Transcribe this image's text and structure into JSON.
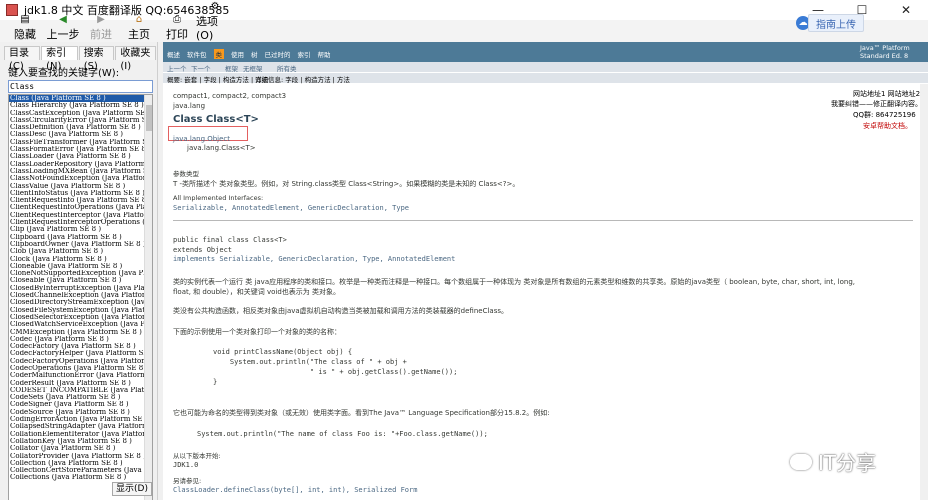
{
  "window": {
    "title": "jdk1.8 中文 百度翻译版 QQ:654638585",
    "controls": [
      "—",
      "☐",
      "✕"
    ]
  },
  "toolbar": {
    "buttons": [
      {
        "label": "隐藏",
        "icon": "hide-icon",
        "enabled": true
      },
      {
        "label": "上一步",
        "icon": "back-icon",
        "enabled": true
      },
      {
        "label": "前进",
        "icon": "forward-icon",
        "enabled": false
      },
      {
        "label": "主页",
        "icon": "home-icon",
        "enabled": true
      },
      {
        "label": "打印",
        "icon": "print-icon",
        "enabled": true
      },
      {
        "label": "选项(O)",
        "icon": "options-icon",
        "enabled": true
      }
    ],
    "cloud_upload": "指南上传"
  },
  "left_panel": {
    "tabs": [
      "目录(C)",
      "索引(N)",
      "搜索(S)",
      "收藏夹(I)"
    ],
    "active_tab": 1,
    "keyword_label": "键入要查找的关键字(W):",
    "search_value": "Class",
    "show_button": "显示(D)",
    "items": [
      "Class (Java Platform SE 8 )",
      "Class Hierarchy (Java Platform SE 8 )",
      "ClassCastException (Java Platform SE 8 )",
      "ClassCircularityError (Java Platform SE 8 )",
      "ClassDefinition (Java Platform SE 8 )",
      "ClassDesc (Java Platform SE 8 )",
      "ClassFileTransformer (Java Platform SE 8 )",
      "ClassFormatError (Java Platform SE 8 )",
      "ClassLoader (Java Platform SE 8 )",
      "ClassLoaderRepository (Java Platform SE 8 )",
      "ClassLoadingMXBean (Java Platform SE 8 )",
      "ClassNotFoundException (Java Platform SE 8 )",
      "ClassValue (Java Platform SE 8 )",
      "ClientInfoStatus (Java Platform SE 8 )",
      "ClientRequestInfo (Java Platform SE 8 )",
      "ClientRequestInfoOperations (Java Platform SE 8 )",
      "ClientRequestInterceptor (Java Platform SE 8 )",
      "ClientRequestInterceptorOperations (Java Platform SE 8 )",
      "Clip (Java Platform SE 8 )",
      "Clipboard (Java Platform SE 8 )",
      "ClipboardOwner (Java Platform SE 8 )",
      "Clob (Java Platform SE 8 )",
      "Clock (Java Platform SE 8 )",
      "Cloneable (Java Platform SE 8 )",
      "CloneNotSupportedException (Java Platform SE 8 )",
      "Closeable (Java Platform SE 8 )",
      "ClosedByInterruptException (Java Platform SE 8 )",
      "ClosedChannelException (Java Platform SE 8 )",
      "ClosedDirectoryStreamException (Java Platform SE 8 )",
      "ClosedFileSystemException (Java Platform SE 8 )",
      "ClosedSelectorException (Java Platform SE 8 )",
      "ClosedWatchServiceException (Java Platform SE 8 )",
      "CMMException (Java Platform SE 8 )",
      "Codec (Java Platform SE 8 )",
      "CodecFactory (Java Platform SE 8 )",
      "CodecFactoryHelper (Java Platform SE 8 )",
      "CodecFactoryOperations (Java Platform SE 8 )",
      "CodecOperations (Java Platform SE 8 )",
      "CoderMalfunctionError (Java Platform SE 8 )",
      "CoderResult (Java Platform SE 8 )",
      "CODESET_INCOMPATIBLE (Java Platform SE 8 )",
      "CodeSets (Java Platform SE 8 )",
      "CodeSigner (Java Platform SE 8 )",
      "CodeSource (Java Platform SE 8 )",
      "CodingErrorAction (Java Platform SE 8 )",
      "CollapsedStringAdapter (Java Platform SE 8 )",
      "CollationElementIterator (Java Platform SE 8 )",
      "CollationKey (Java Platform SE 8 )",
      "Collator (Java Platform SE 8 )",
      "CollatorProvider (Java Platform SE 8 )",
      "Collection (Java Platform SE 8 )",
      "CollectionCertStoreParameters (Java Platform SE 8 )",
      "Collections (Java Platform SE 8 )"
    ]
  },
  "doc": {
    "navbar_links": [
      "概述",
      "软件包",
      "类",
      "使用",
      "树",
      "已过时的",
      "索引",
      "帮助"
    ],
    "navbar_current": 2,
    "brand_line1": "Java™ Platform",
    "brand_line2": "Standard Ed. 8",
    "subnav1": [
      "上一个",
      "下一个",
      "框架",
      "无框架",
      "所有类"
    ],
    "subnav2": [
      "概要: 嵌套 | 字段 | 构造方法 | 方法",
      "详细信息: 字段 | 构造方法 | 方法"
    ],
    "profiles": "compact1, compact2, compact3",
    "package": "java.lang",
    "class_title": "Class Class<T>",
    "inherit_parent": "java.lang.Object",
    "inherit_child": "java.lang.Class<T>",
    "ad_lines": [
      "网站地址1 网站地址2",
      "我要纠错——修正翻译内容。",
      "QQ群: 864725196",
      "安卓帮助文档。"
    ],
    "type_params_label": "参数类型",
    "type_params_text": "T -类所描述个 类对象类型。例如，对 String.class类型 Class<String>。如果模糊的类是未知的 Class<?>。",
    "interfaces_label": "All Implemented Interfaces:",
    "interfaces": "Serializable,  AnnotatedElement,  GenericDeclaration,  Type",
    "decl_line1": "public final class Class<T>",
    "decl_line2": "extends Object",
    "decl_line3": "implements Serializable, GenericDeclaration, Type, AnnotatedElement",
    "para1": "类的实例代表一个运行 类 java应用程序的类和接口。枚举是一种类而注释是一种接口。每个数组属于一种体现为 类对象是所有数组的元素类型和维数的共享类。原始的java类型（ boolean, byte, char, short, int, long,",
    "para1b": "float, 和 double），和关键词 void也表示为 类对象。",
    "para2": "类没有公共构造函数，相反类对象由java虚拟机自动构造当类被加载和调用方法的类装载器的defineClass。",
    "para3": "下面的示例使用一个类对象打印一个对象的类的名称：",
    "code": [
      "void printClassName(Object obj) {",
      "    System.out.println(\"The class of \" + obj +",
      "                       \" is \" + obj.getClass().getName());",
      "}"
    ],
    "para4": "它也可能为命名的类型得到类对象（或无效）使用类字面。看到The Java™ Language Specification部分15.8.2。例如:",
    "code2": "System.out.println(\"The name of class Foo is: \"+Foo.class.getName());",
    "since_label": "从以下版本开始:",
    "since_value": "JDK1.0",
    "see_label": "另请参见:",
    "see_value": "ClassLoader.defineClass(byte[], int, int),  Serialized Form"
  },
  "watermark": "IT分享"
}
